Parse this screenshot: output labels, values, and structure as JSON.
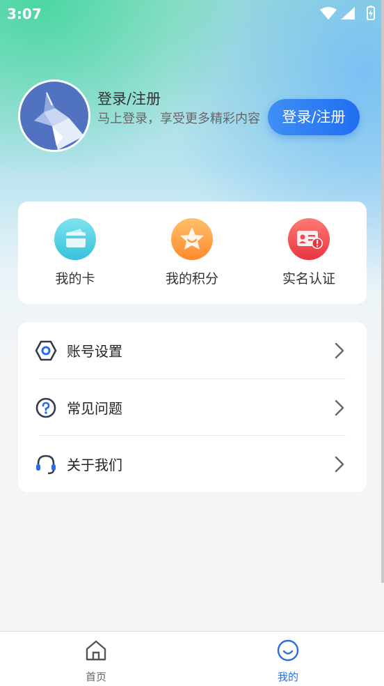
{
  "status_bar": {
    "time": "3:07"
  },
  "profile": {
    "title": "登录/注册",
    "subtitle": "马上登录，享受更多精彩内容",
    "login_button": "登录/注册"
  },
  "quick_actions": [
    {
      "label": "我的卡",
      "icon": "card-icon",
      "color": "#4fd0e6"
    },
    {
      "label": "我的积分",
      "icon": "star-icon",
      "color": "#ff9a3a"
    },
    {
      "label": "实名认证",
      "icon": "id-card-alert-icon",
      "color": "#f0484e"
    }
  ],
  "menu": [
    {
      "label": "账号设置",
      "icon": "settings-hexagon-icon"
    },
    {
      "label": "常见问题",
      "icon": "question-circle-icon"
    },
    {
      "label": "关于我们",
      "icon": "headset-icon"
    }
  ],
  "tabbar": {
    "items": [
      {
        "label": "首页",
        "icon": "home-icon",
        "active": false
      },
      {
        "label": "我的",
        "icon": "smile-icon",
        "active": true
      }
    ],
    "active_color": "#2a6de8",
    "inactive_color": "#666666"
  }
}
